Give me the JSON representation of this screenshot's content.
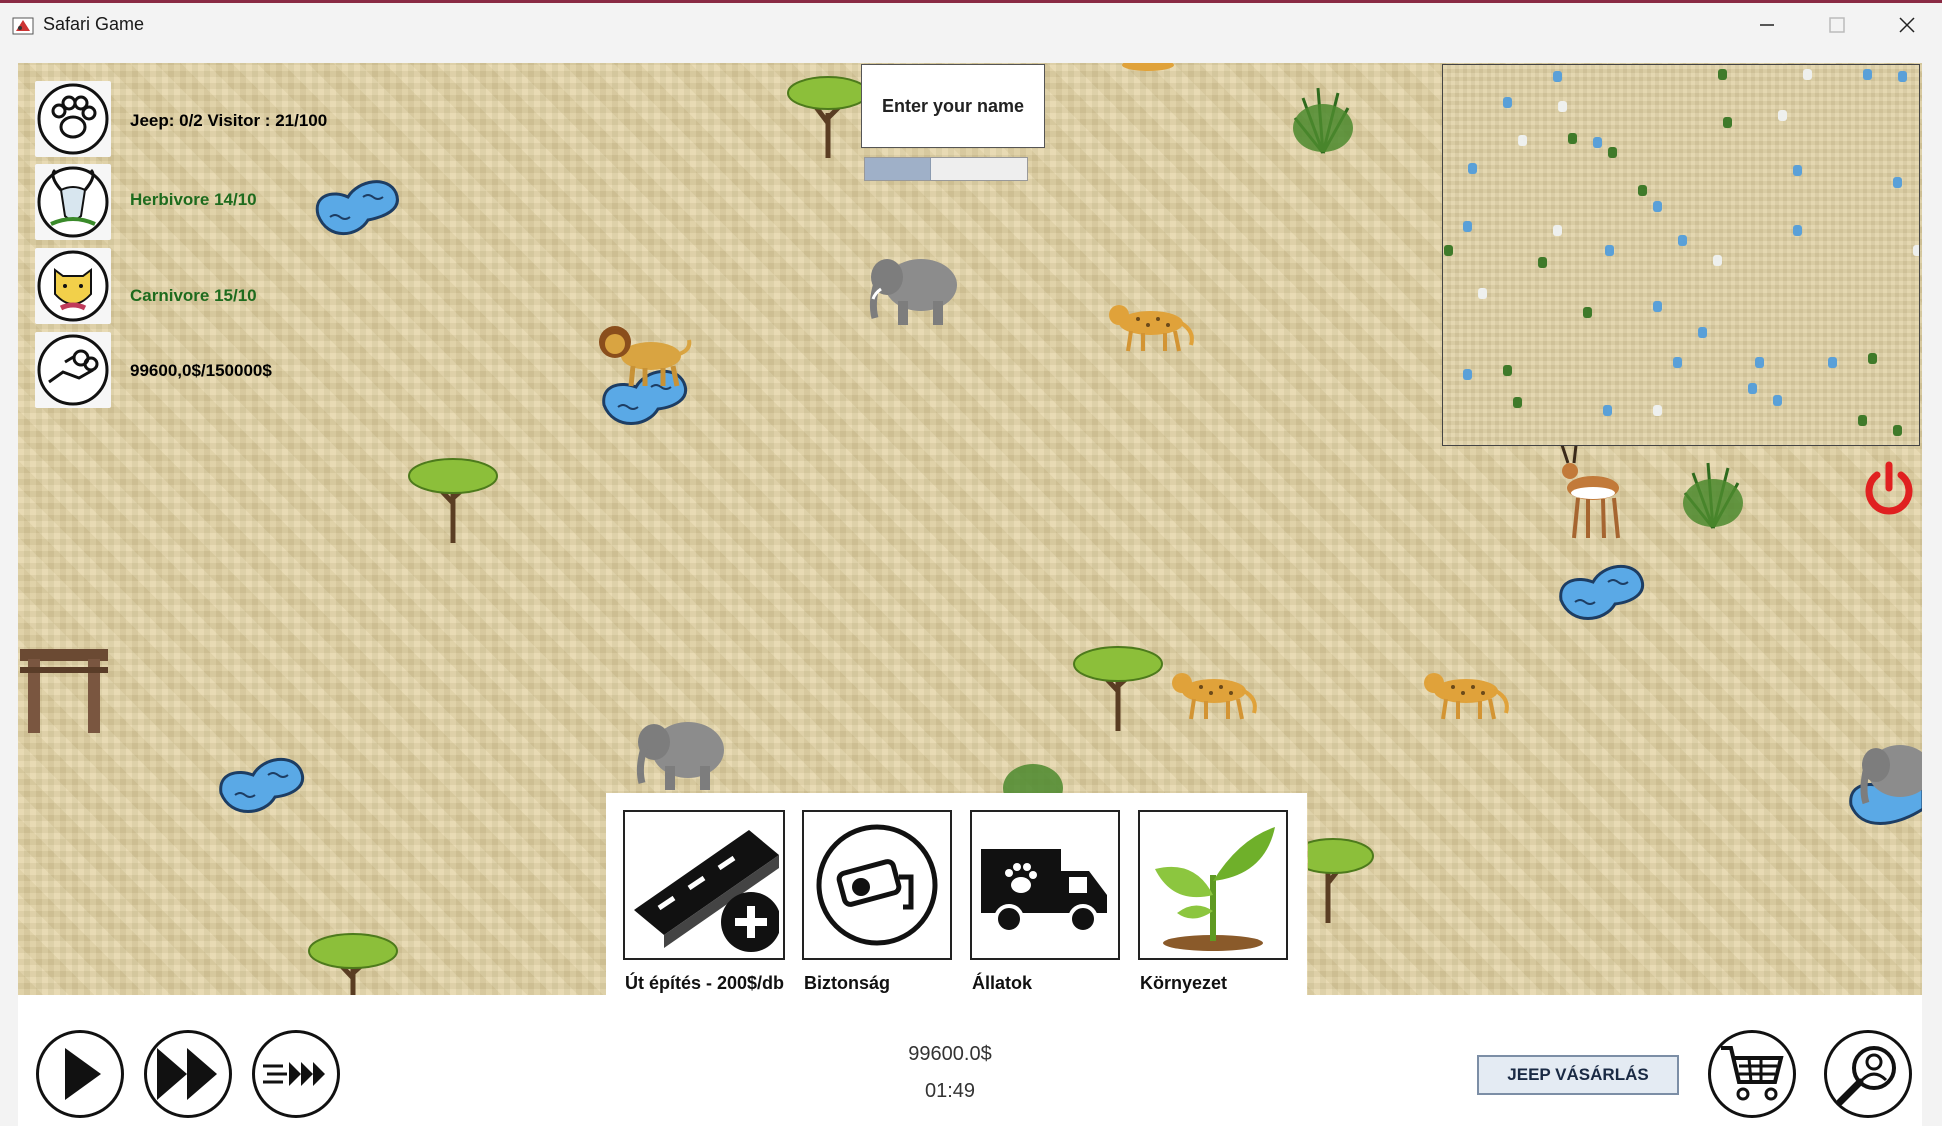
{
  "window": {
    "title": "Safari Game"
  },
  "stats": {
    "jeep_visitor": "Jeep: 0/2 Visitor : 21/100",
    "herbivore": "Herbivore 14/10",
    "carnivore": "Carnivore 15/10",
    "money": "99600,0$/150000$",
    "colors": {
      "label_default": "#111111",
      "label_good": "#1e6b1e"
    }
  },
  "name_input": {
    "placeholder": "Enter your name",
    "progress_fraction": 0.4
  },
  "build_menu": {
    "items": [
      {
        "label": "Út építés - 200$/db",
        "icon": "road-plus-icon"
      },
      {
        "label": "Biztonság",
        "icon": "security-camera-icon"
      },
      {
        "label": "Állatok",
        "icon": "animal-truck-icon"
      },
      {
        "label": "Környezet",
        "icon": "plant-sprout-icon"
      }
    ]
  },
  "bottom": {
    "money": "99600.0$",
    "time": "01:49",
    "jeep_button": "JEEP VÁSÁRLÁS"
  },
  "colors": {
    "sand": "#e2d3a5",
    "water": "#5aa9e6",
    "power": "#e02020"
  }
}
